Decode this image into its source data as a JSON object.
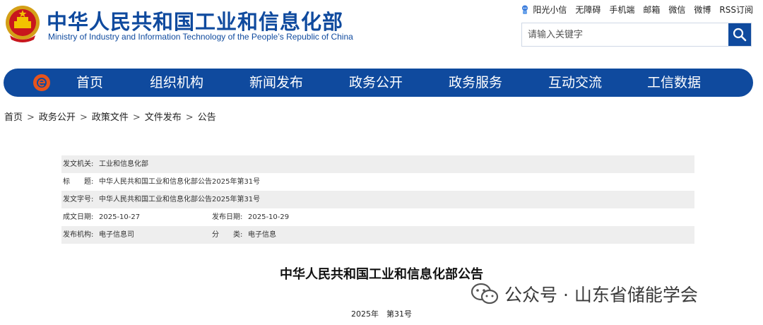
{
  "site": {
    "title_cn": "中华人民共和国工业和信息化部",
    "title_en": "Ministry of Industry and Information Technology of the People’s Republic of China"
  },
  "toplinks": [
    "阳光小信",
    "无障碍",
    "手机端",
    "邮箱",
    "微信",
    "微博",
    "RSS订阅"
  ],
  "search": {
    "placeholder": "请输入关键字"
  },
  "nav": [
    "首页",
    "组织机构",
    "新闻发布",
    "政务公开",
    "政务服务",
    "互动交流",
    "工信数据"
  ],
  "breadcrumb": [
    "首页",
    "政务公开",
    "政策文件",
    "文件发布",
    "公告"
  ],
  "meta": {
    "issuer_label": "发文机关:",
    "issuer": "工业和信息化部",
    "title_label": "标　　题:",
    "title": "中华人民共和国工业和信息化部公告2025年第31号",
    "doc_no_label": "发文字号:",
    "doc_no": "中华人民共和国工业和信息化部公告2025年第31号",
    "created_label": "成文日期:",
    "created": "2025-10-27",
    "published_label": "发布日期:",
    "published": "2025-10-29",
    "org_label": "发布机构:",
    "org": "电子信息司",
    "category_label": "分　　类:",
    "category": "电子信息"
  },
  "document": {
    "title": "中华人民共和国工业和信息化部公告",
    "number": "2025年　第31号"
  },
  "watermark": {
    "text": "公众号 · 山东省储能学会"
  },
  "colors": {
    "brand_blue": "#0f4a9e",
    "meta_shade": "#eeeeee"
  }
}
